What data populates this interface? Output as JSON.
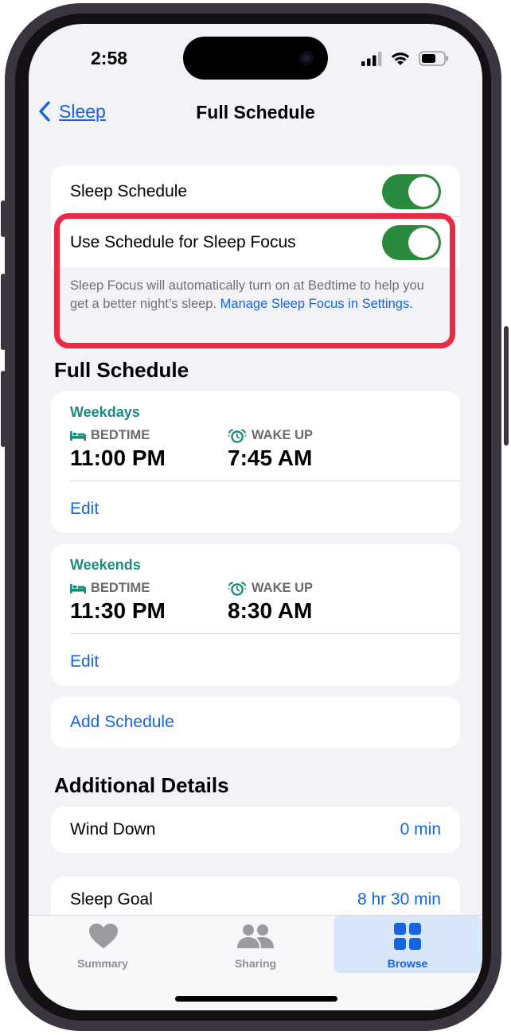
{
  "status": {
    "time": "2:58"
  },
  "nav": {
    "back_label": "Sleep",
    "title": "Full Schedule"
  },
  "settings_card": {
    "sleep_schedule_label": "Sleep Schedule",
    "sleep_schedule_on": true,
    "use_focus_label": "Use Schedule for Sleep Focus",
    "use_focus_on": true,
    "description": "Sleep Focus will automatically turn on at Bedtime to help you get a better night’s sleep. ",
    "description_link": "Manage Sleep Focus in Settings."
  },
  "full_schedule": {
    "heading": "Full Schedule",
    "schedules": [
      {
        "title": "Weekdays",
        "bedtime_label": "BEDTIME",
        "bedtime": "11:00 PM",
        "wake_label": "WAKE UP",
        "wake": "7:45 AM",
        "edit_label": "Edit"
      },
      {
        "title": "Weekends",
        "bedtime_label": "BEDTIME",
        "bedtime": "11:30 PM",
        "wake_label": "WAKE UP",
        "wake": "8:30 AM",
        "edit_label": "Edit"
      }
    ],
    "add_schedule_label": "Add Schedule"
  },
  "additional": {
    "heading": "Additional Details",
    "wind_down_label": "Wind Down",
    "wind_down_value": "0 min",
    "sleep_goal_label": "Sleep Goal",
    "sleep_goal_value": "8 hr 30 min"
  },
  "tabbar": {
    "tabs": [
      {
        "label": "Summary",
        "icon": "heart-icon"
      },
      {
        "label": "Sharing",
        "icon": "people-icon"
      },
      {
        "label": "Browse",
        "icon": "grid-icon",
        "active": true
      }
    ]
  },
  "colors": {
    "accent": "#1565e0",
    "toggle_on": "#2a8a3e",
    "schedule_title": "#1c8c7a",
    "highlight": "#ea2a44"
  }
}
